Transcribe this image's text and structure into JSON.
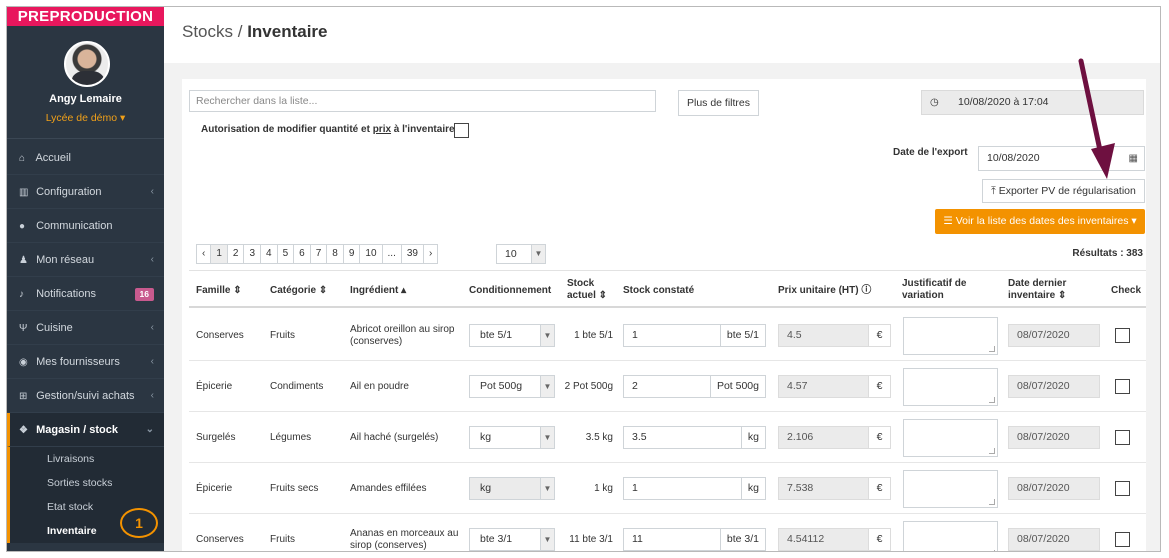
{
  "env_banner": "PREPRODUCTION",
  "user": {
    "name": "Angy Lemaire",
    "school": "Lycée de démo ▾"
  },
  "nav": [
    {
      "label": "Accueil",
      "icon": "home-icon",
      "glyph": "⌂"
    },
    {
      "label": "Configuration",
      "icon": "bank-icon",
      "glyph": "▥"
    },
    {
      "label": "Communication",
      "icon": "comments-icon",
      "glyph": "●"
    },
    {
      "label": "Mon réseau",
      "icon": "users-icon",
      "glyph": "♟"
    },
    {
      "label": "Notifications",
      "icon": "bell-icon",
      "glyph": "♪",
      "badge": "16"
    },
    {
      "label": "Cuisine",
      "icon": "cutlery-icon",
      "glyph": "Ψ"
    },
    {
      "label": "Mes fournisseurs",
      "icon": "eye-icon",
      "glyph": "◉"
    },
    {
      "label": "Gestion/suivi achats",
      "icon": "cart-icon",
      "glyph": "⊞"
    }
  ],
  "nav_active": {
    "label": "Magasin / stock",
    "icon": "cubes-icon",
    "glyph": "❖"
  },
  "sub_nav": [
    "Livraisons",
    "Sorties stocks",
    "Etat stock",
    "Inventaire"
  ],
  "step_marker": "1",
  "breadcrumb": {
    "parent": "Stocks / ",
    "current": "Inventaire"
  },
  "search": {
    "placeholder": "Rechercher dans la liste..."
  },
  "filters_button": "Plus de filtres",
  "datetime": "10/08/2020 à 17:04",
  "autorisation": {
    "before": "Autorisation de modifier quantité et ",
    "link": "prix",
    "after": " à l'inventaire"
  },
  "export": {
    "label": "Date de l'export",
    "date": "10/08/2020",
    "pv_button": "⤒ Exporter PV de régularisation",
    "dates_button": "☰ Voir la liste des dates des inventaires ▾"
  },
  "pagination": [
    "‹",
    "1",
    "2",
    "3",
    "4",
    "5",
    "6",
    "7",
    "8",
    "9",
    "10",
    "...",
    "39",
    "›"
  ],
  "per_page": "10",
  "results": "Résultats : 383",
  "columns": {
    "famille": "Famille ⇕",
    "categorie": "Catégorie ⇕",
    "ingredient": "Ingrédient ▴",
    "conditionnement": "Conditionnement",
    "stock_actuel_1": "Stock",
    "stock_actuel_2": "actuel ⇕",
    "stock_constate": "Stock constaté",
    "prix": "Prix unitaire (HT) ⓘ",
    "justificatif_1": "Justificatif de",
    "justificatif_2": "variation",
    "date_1": "Date dernier",
    "date_2": "inventaire ⇕",
    "check": "Check"
  },
  "rows": [
    {
      "famille": "Conserves",
      "categorie": "Fruits",
      "ingredient_1": "Abricot oreillon au sirop",
      "ingredient_2": "(conserves)",
      "cond": "bte 5/1",
      "stock": "1 bte 5/1",
      "constate": "1",
      "unit": "bte 5/1",
      "prix": "4.5",
      "cur": "€",
      "date": "08/07/2020"
    },
    {
      "famille": "Épicerie",
      "categorie": "Condiments",
      "ingredient_1": "Ail en poudre",
      "ingredient_2": "",
      "cond": "Pot 500g",
      "stock": "2 Pot 500g",
      "constate": "2",
      "unit": "Pot 500g",
      "prix": "4.57",
      "cur": "€",
      "date": "08/07/2020"
    },
    {
      "famille": "Surgelés",
      "categorie": "Légumes",
      "ingredient_1": "Ail haché (surgelés)",
      "ingredient_2": "",
      "cond": "kg",
      "stock": "3.5 kg",
      "constate": "3.5",
      "unit": "kg",
      "prix": "2.106",
      "cur": "€",
      "date": "08/07/2020"
    },
    {
      "famille": "Épicerie",
      "categorie": "Fruits secs",
      "ingredient_1": "Amandes effilées",
      "ingredient_2": "",
      "cond": "kg",
      "stock": "1 kg",
      "constate": "1",
      "unit": "kg",
      "prix": "7.538",
      "cur": "€",
      "date": "08/07/2020"
    },
    {
      "famille": "Conserves",
      "categorie": "Fruits",
      "ingredient_1": "Ananas en morceaux au",
      "ingredient_2": "sirop (conserves)",
      "cond": "bte 3/1",
      "stock": "11 bte 3/1",
      "constate": "11",
      "unit": "bte 3/1",
      "prix": "4.54112",
      "cur": "€",
      "date": "08/07/2020"
    }
  ]
}
